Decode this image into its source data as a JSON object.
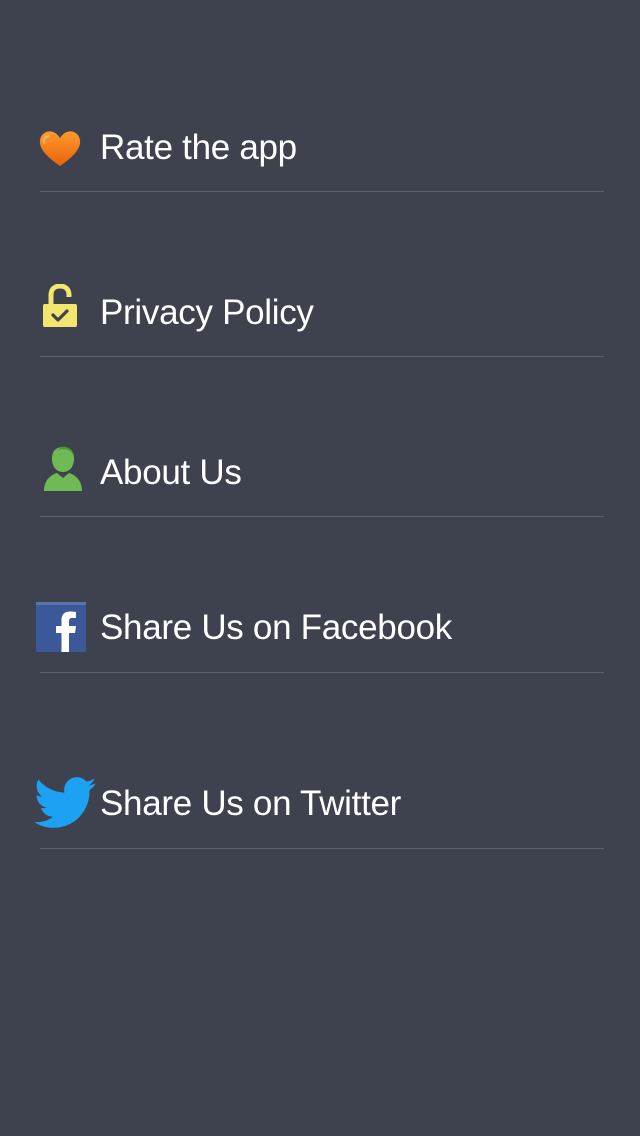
{
  "menu": {
    "items": [
      {
        "label": "Rate the app",
        "icon": "heart-icon",
        "icon_color": "#f07b14"
      },
      {
        "label": "Privacy Policy",
        "icon": "unlocked-padlock-icon",
        "icon_color": "#f3e66e"
      },
      {
        "label": "About Us",
        "icon": "person-icon",
        "icon_color": "#6fba55"
      },
      {
        "label": "Share Us on Facebook",
        "icon": "facebook-icon",
        "icon_color": "#3b5998"
      },
      {
        "label": "Share Us on Twitter",
        "icon": "twitter-icon",
        "icon_color": "#1da1f2"
      }
    ]
  },
  "colors": {
    "background": "#3d424e",
    "divider": "#5b606b",
    "text": "#ffffff"
  }
}
